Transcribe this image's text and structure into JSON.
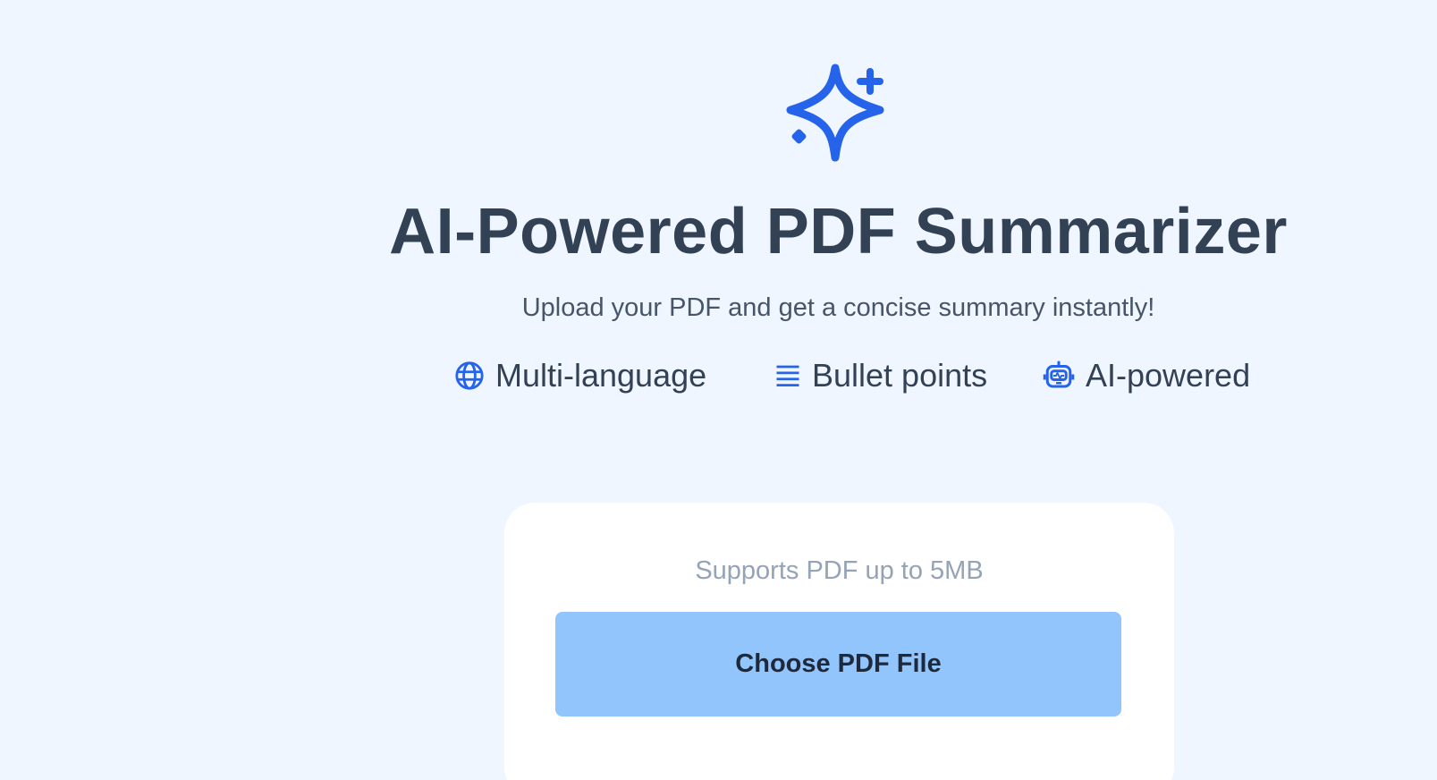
{
  "header": {
    "icon": "sparkles-icon",
    "title": "AI-Powered PDF Summarizer",
    "subtitle": "Upload your PDF and get a concise summary instantly!"
  },
  "features": [
    {
      "icon": "globe-icon",
      "label": "Multi-language"
    },
    {
      "icon": "list-icon",
      "label": "Bullet points"
    },
    {
      "icon": "robot-icon",
      "label": "AI-powered"
    }
  ],
  "upload": {
    "support_text": "Supports PDF up to 5MB",
    "button_label": "Choose PDF File"
  },
  "colors": {
    "background": "#eff6ff",
    "accent": "#2563eb",
    "title": "#334155",
    "button": "#93c5fd",
    "card": "#ffffff"
  }
}
